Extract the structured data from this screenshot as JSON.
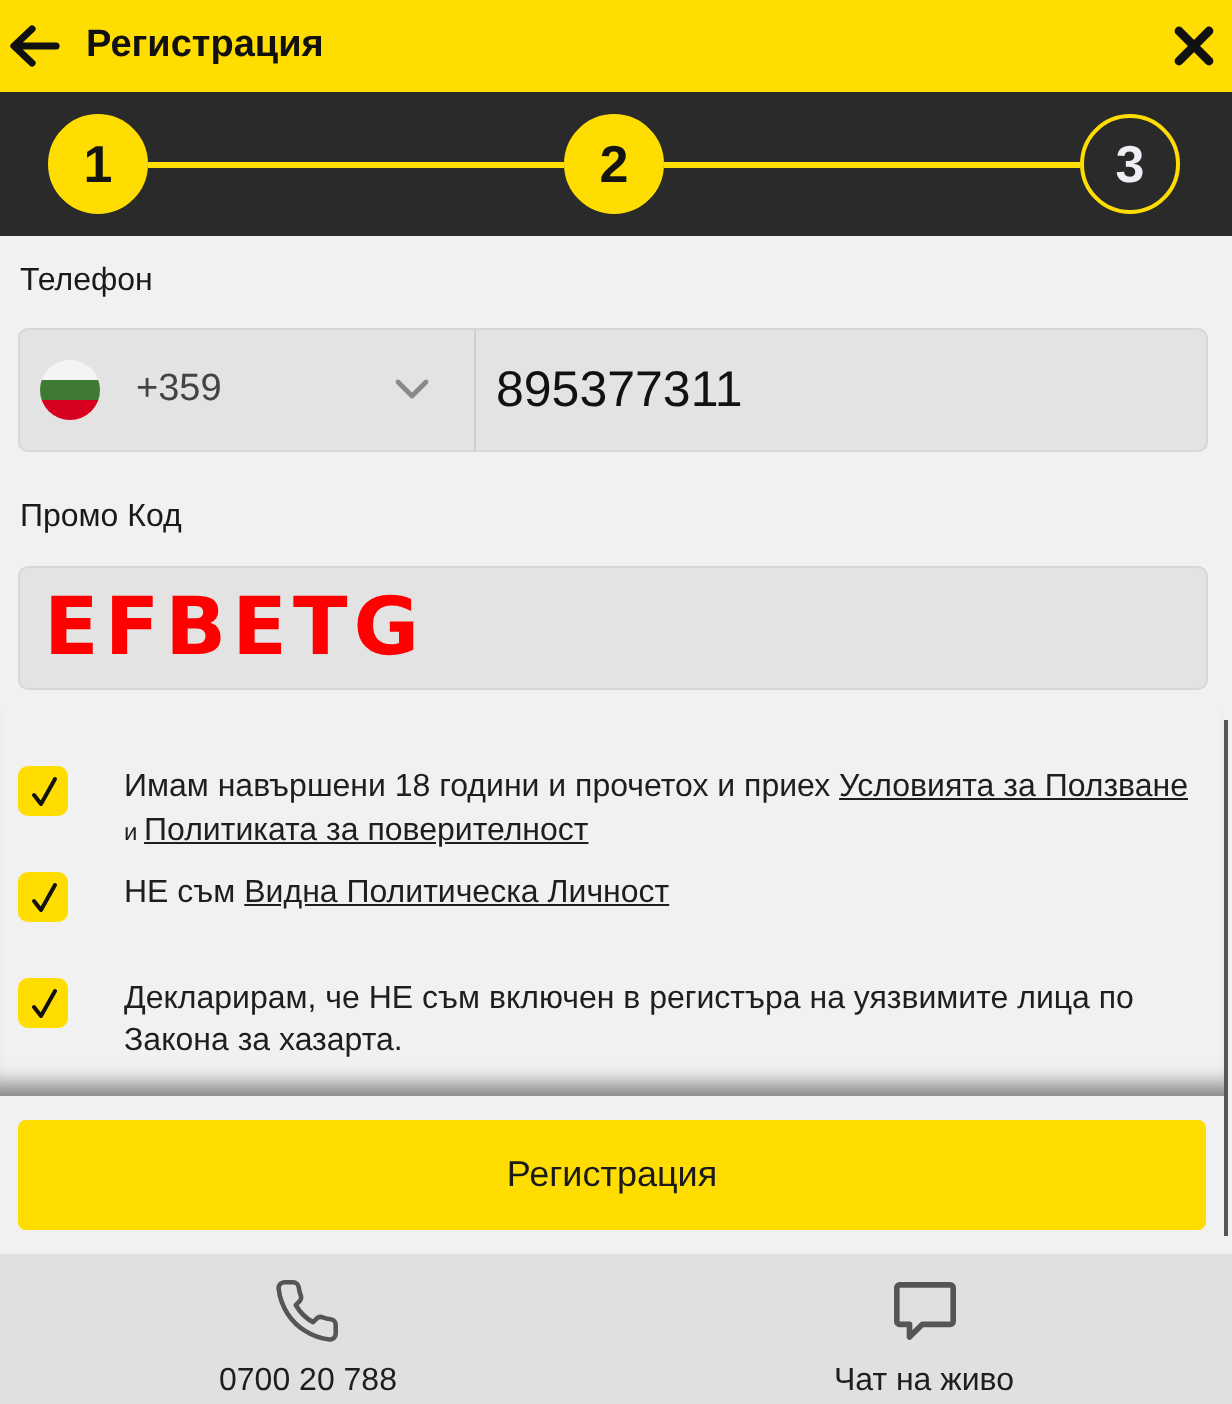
{
  "header": {
    "title": "Регистрация"
  },
  "steps": [
    {
      "label": "1",
      "completed": true
    },
    {
      "label": "2",
      "completed": true
    },
    {
      "label": "3",
      "completed": false
    }
  ],
  "phone": {
    "label": "Телефон",
    "country_code": "+359",
    "value": "895377311"
  },
  "promo": {
    "label": "Промо Код",
    "value": "EFBETG"
  },
  "consents": [
    {
      "checked": true,
      "parts": [
        {
          "kind": "text",
          "text": "Имам навършени 18 години и прочетох и приех "
        },
        {
          "kind": "link",
          "text": "Условията за Ползване"
        },
        {
          "kind": "small",
          "text": " и "
        },
        {
          "kind": "link",
          "text": "Политиката за поверителност"
        }
      ]
    },
    {
      "checked": true,
      "parts": [
        {
          "kind": "text",
          "text": "НЕ съм "
        },
        {
          "kind": "link",
          "text": "Видна Политическа Личност"
        }
      ]
    },
    {
      "checked": true,
      "parts": [
        {
          "kind": "text",
          "text": "Декларирам, че НЕ съм включен в регистъра на уязвимите лица по Закона за хазарта."
        }
      ]
    }
  ],
  "submit": {
    "label": "Регистрация"
  },
  "footer": [
    {
      "kind": "phone",
      "label": "0700 20 788"
    },
    {
      "kind": "chat",
      "label": "Чат на живо"
    }
  ]
}
